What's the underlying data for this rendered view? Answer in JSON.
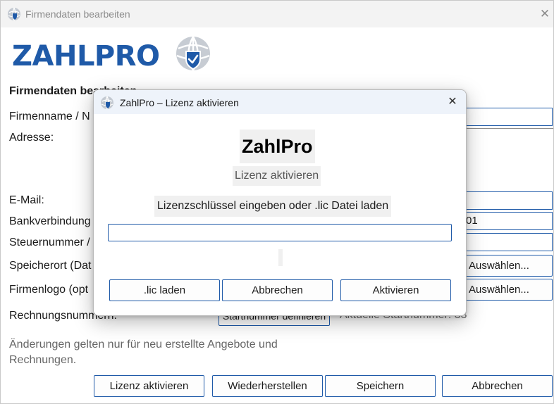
{
  "window": {
    "title": "Firmendaten bearbeiten",
    "close_glyph": "✕"
  },
  "logo": {
    "text": "ZAHLPRO",
    "icon": "globe-shield-icon"
  },
  "form": {
    "heading": "Firmendaten bearbeiten",
    "labels": {
      "firmenname": "Firmenname / N",
      "adresse": "Adresse:",
      "email": "E-Mail:",
      "bank": "Bankverbindung",
      "steuer": "Steuernummer /",
      "speicherort": "Speicherort (Dat",
      "logo": "Firmenlogo (opt",
      "rechnung": "Rechnungsnummern:"
    },
    "bank_value_fragment": "01",
    "auswaehlen_label": "Auswählen...",
    "startnummer_button": "Startnummer definieren",
    "current_start": "Aktuelle Startnummer: 33",
    "note": "Änderungen gelten nur für neu erstellte Angebote und Rechnungen."
  },
  "bottom_buttons": {
    "lizenz": "Lizenz aktivieren",
    "wiederherstellen": "Wiederherstellen",
    "speichern": "Speichern",
    "abbrechen": "Abbrechen"
  },
  "dialog": {
    "title": "ZahlPro – Lizenz aktivieren",
    "close_glyph": "✕",
    "brand": "ZahlPro",
    "subtitle": "Lizenz aktivieren",
    "instruction": "Lizenzschlüssel eingeben oder .lic Datei laden",
    "input_value": "",
    "input_placeholder": "",
    "buttons": {
      "lic_laden": ".lic laden",
      "abbrechen": "Abbrechen",
      "aktivieren": "Aktivieren"
    }
  },
  "colors": {
    "accent": "#1f5aa8",
    "window_bg": "#f3f3f3",
    "dialog_title_bg": "#eef3fa"
  }
}
